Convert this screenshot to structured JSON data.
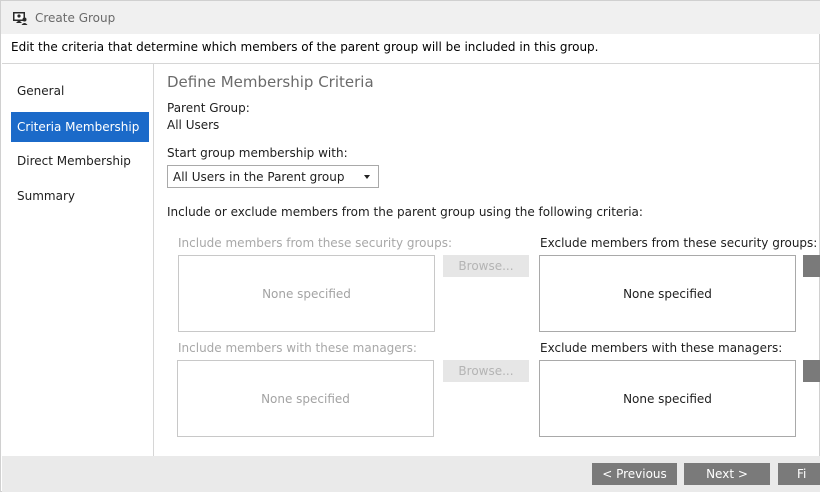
{
  "window": {
    "title": "Create Group",
    "icon": "group-icon"
  },
  "instruction": "Edit the criteria that determine which members of the parent group will be included in this group.",
  "sidebar": {
    "items": [
      {
        "label": "General"
      },
      {
        "label": "Criteria Membership",
        "active": true
      },
      {
        "label": "Direct Membership"
      },
      {
        "label": "Summary"
      }
    ]
  },
  "main": {
    "title": "Define Membership Criteria",
    "parent_group_label": "Parent Group:",
    "parent_group_value": "All Users",
    "start_label": "Start group membership with:",
    "start_value": "All Users in the Parent group",
    "criteria_intro": "Include or exclude members from the parent group using the following criteria:",
    "include_groups": {
      "label": "Include members from these security groups:",
      "value": "None specified",
      "browse": "Browse..."
    },
    "exclude_groups": {
      "label": "Exclude members from these security groups:",
      "value": "None specified"
    },
    "include_managers": {
      "label": "Include members with these managers:",
      "value": "None specified",
      "browse": "Browse..."
    },
    "exclude_managers": {
      "label": "Exclude members with these managers:",
      "value": "None specified"
    }
  },
  "footer": {
    "previous": "< Previous",
    "next": "Next >",
    "finish": "Fi"
  },
  "colors": {
    "accent": "#1b6ac9",
    "button": "#7a7a7a"
  }
}
